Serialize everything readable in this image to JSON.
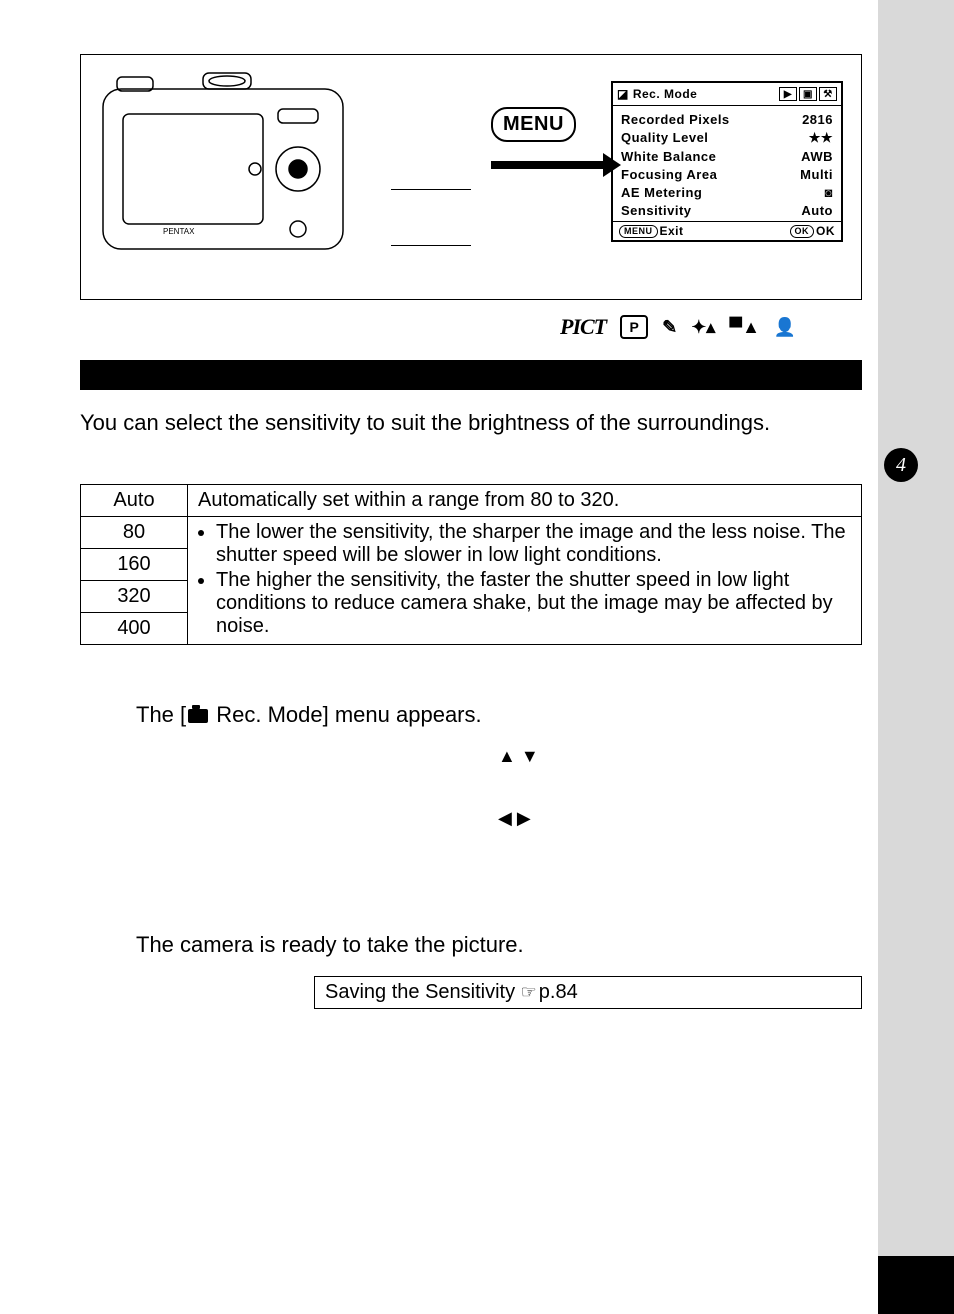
{
  "chapter_tab": "4",
  "menu_button_label": "MENU",
  "mode_row": {
    "pict": "PICT",
    "p_label": "P"
  },
  "intro_text": "You can select the sensitivity to suit the brightness of the surroundings.",
  "lcd_menu": {
    "title": "Rec. Mode",
    "items": [
      {
        "label": "Recorded Pixels",
        "value": "2816"
      },
      {
        "label": "Quality Level",
        "value": "★★"
      },
      {
        "label": "White Balance",
        "value": "AWB"
      },
      {
        "label": "Focusing Area",
        "value": "Multi"
      },
      {
        "label": "AE Metering",
        "value": "◙"
      },
      {
        "label": "Sensitivity",
        "value": "Auto"
      }
    ],
    "footer_left_btn": "MENU",
    "footer_left_text": "Exit",
    "footer_right_btn": "OK",
    "footer_right_text": "OK"
  },
  "sens_table": {
    "auto_label": "Auto",
    "auto_desc": "Automatically set within a range from 80 to 320.",
    "rows": [
      "80",
      "160",
      "320",
      "400"
    ],
    "bullet1": "The lower the sensitivity, the sharper the image and the less noise. The shutter speed will be slower in low light conditions.",
    "bullet2": "The higher the sensitivity, the faster the shutter speed in low light conditions to reduce camera shake,  but the image may be affected by noise."
  },
  "step1_prefix": "The [",
  "step1_suffix": " Rec. Mode] menu appears.",
  "step3_text": "The camera is ready to take the picture.",
  "ref_text": "Saving the Sensitivity ",
  "ref_page": "p.84"
}
